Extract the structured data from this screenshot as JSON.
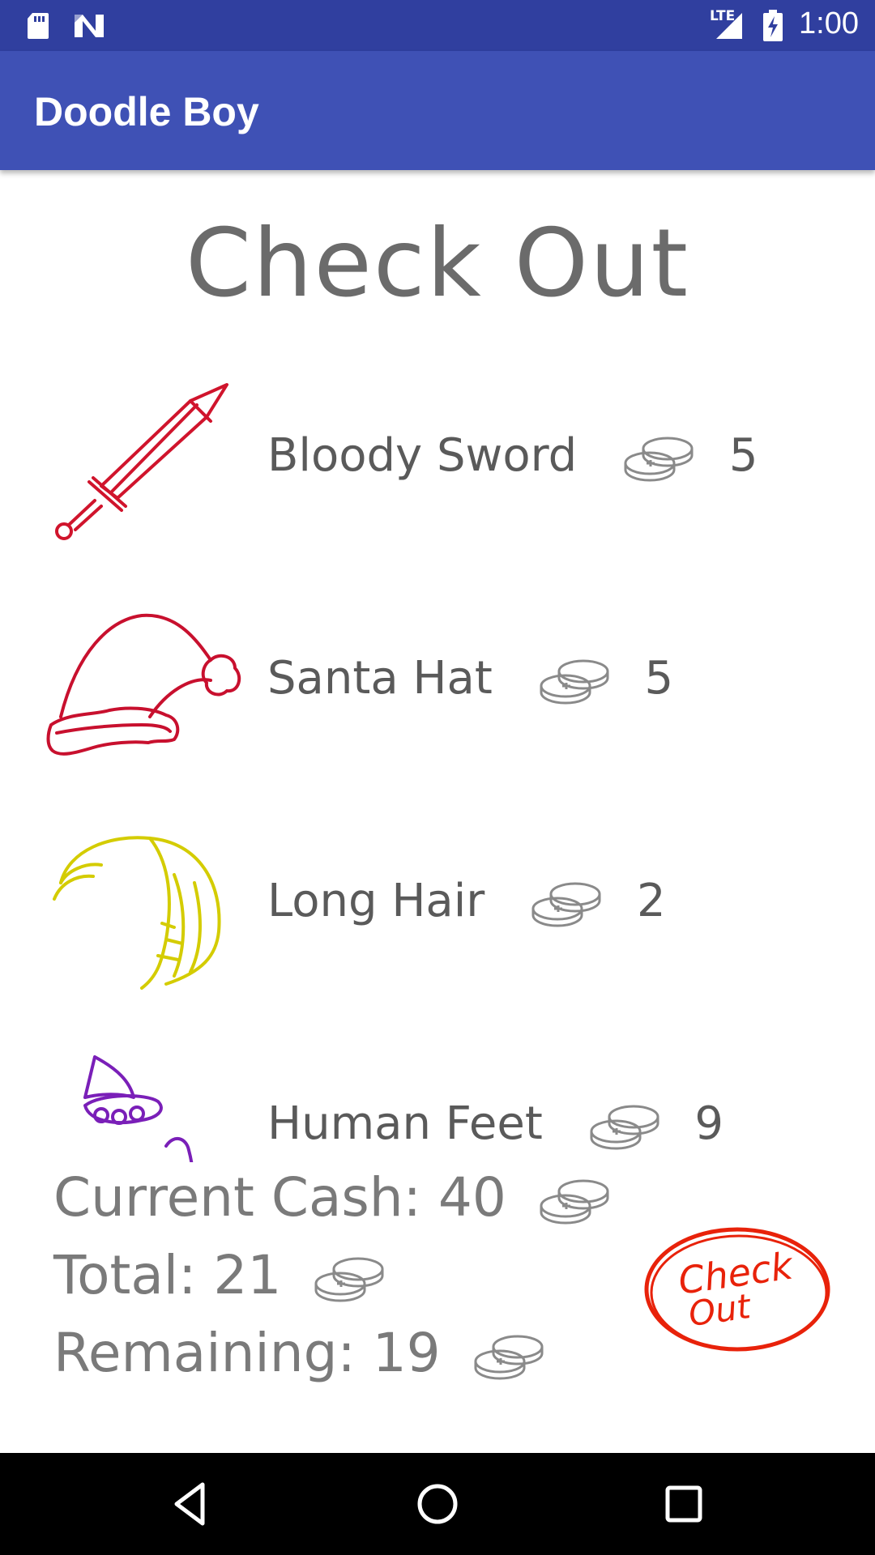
{
  "status_bar": {
    "network_label": "LTE",
    "time": "1:00",
    "icons": [
      "sd-card-icon",
      "n-notification-icon",
      "signal-icon",
      "battery-charging-icon"
    ]
  },
  "app_bar": {
    "title": "Doodle Boy"
  },
  "page": {
    "heading": "Check Out"
  },
  "items": [
    {
      "name": "Bloody Sword",
      "price": "5",
      "icon": "sword-icon",
      "color": "#d0142c"
    },
    {
      "name": "Santa Hat",
      "price": "5",
      "icon": "santa-hat-icon",
      "color": "#c8102e"
    },
    {
      "name": "Long Hair",
      "price": "2",
      "icon": "long-hair-icon",
      "color": "#d4cc00"
    },
    {
      "name": "Human Feet",
      "price": "9",
      "icon": "feet-icon",
      "color": "#7a1fb8"
    }
  ],
  "summary": {
    "current_cash_label": "Current Cash:",
    "current_cash": "40",
    "total_label": "Total:",
    "total": "21",
    "remaining_label": "Remaining:",
    "remaining": "19"
  },
  "checkout_button": {
    "line1": "Check",
    "line2": "Out",
    "color": "#e8220a"
  },
  "nav_bar": {
    "icons": [
      "back-icon",
      "home-icon",
      "recents-icon"
    ]
  },
  "colors": {
    "status_bar": "#303f9f",
    "app_bar": "#3f51b5",
    "text_gray": "#5a5a5a"
  }
}
